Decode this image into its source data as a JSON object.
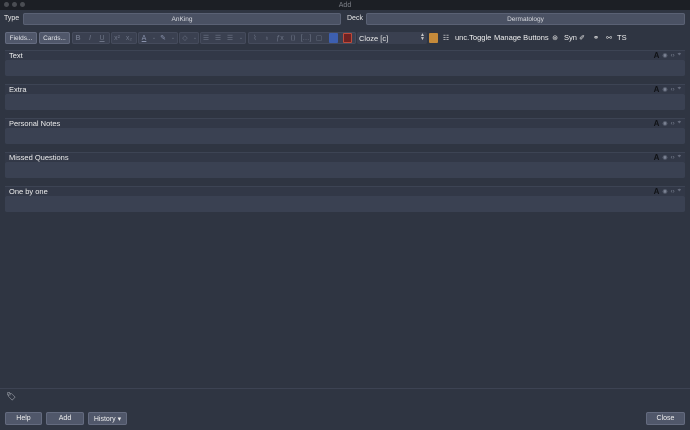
{
  "window": {
    "title": "Add"
  },
  "note_type": {
    "label": "Type",
    "value": "AnKing"
  },
  "deck": {
    "label": "Deck",
    "value": "Dermatology"
  },
  "toolbar": {
    "fields_label": "Fields...",
    "cards_label": "Cards...",
    "cloze_select": "Cloze [c]",
    "unc_toggle_label": "unc.Toggle",
    "manage_buttons_label": "Manage Buttons",
    "syn_label": "Syn",
    "ts_label": "TS",
    "icons": [
      "bold-icon",
      "italic-icon",
      "underline-icon",
      "superscript-icon",
      "subscript-icon",
      "text-color-icon",
      "highlight-icon",
      "eraser-icon",
      "unordered-list-icon",
      "ordered-list-icon",
      "indent-icon",
      "attach-icon",
      "record-icon",
      "mathjax-icon",
      "html-icon",
      "cloze-icon",
      "image-occlusion-icon",
      "link-icon",
      "unlink-icon"
    ]
  },
  "fields": [
    {
      "name": "Text",
      "value": ""
    },
    {
      "name": "Extra",
      "value": ""
    },
    {
      "name": "Personal Notes",
      "value": ""
    },
    {
      "name": "Missed Questions",
      "value": ""
    },
    {
      "name": "One by one",
      "value": ""
    }
  ],
  "buttons": {
    "help": "Help",
    "add": "Add",
    "history": "History ▾",
    "close": "Close"
  },
  "colors": {
    "background": "#2f3542",
    "field": "#3a4152",
    "button": "#50576a"
  }
}
